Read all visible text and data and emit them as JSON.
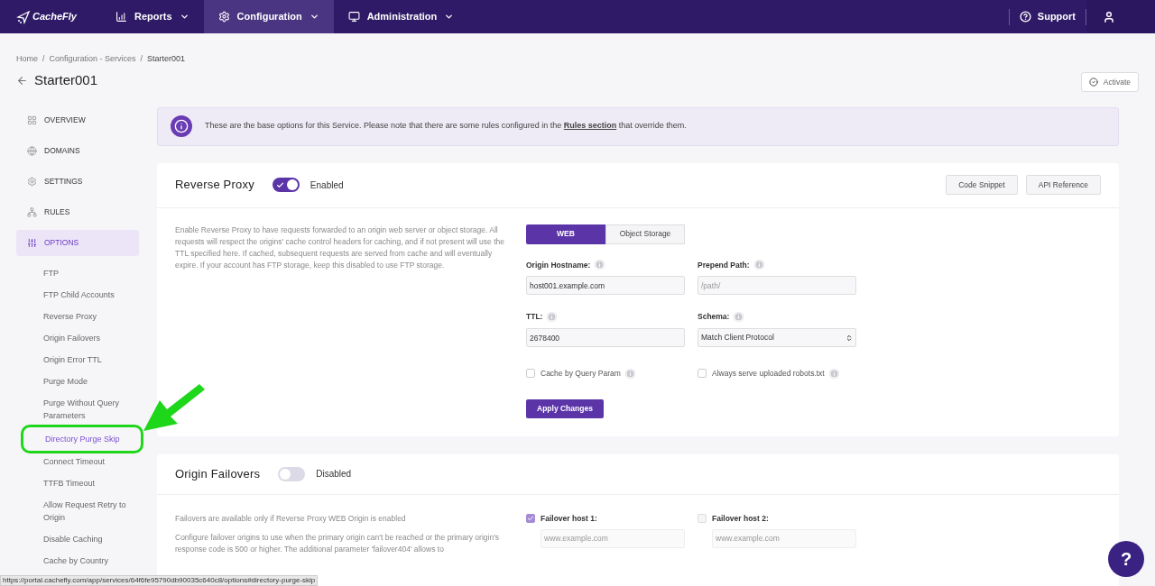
{
  "nav": {
    "logo": "CacheFly",
    "items": [
      {
        "label": "Reports",
        "selected": false
      },
      {
        "label": "Configuration",
        "selected": true
      },
      {
        "label": "Administration",
        "selected": false
      }
    ],
    "support": "Support"
  },
  "breadcrumb": [
    "Home",
    "Configuration - Services",
    "Starter001"
  ],
  "breadcrumb_separator": "/",
  "title": "Starter001",
  "activate_button": "Activate",
  "sidebar": {
    "sections": [
      {
        "label": "OVERVIEW",
        "selected": false
      },
      {
        "label": "DOMAINS",
        "selected": false
      },
      {
        "label": "SETTINGS",
        "selected": false
      },
      {
        "label": "RULES",
        "selected": false
      },
      {
        "label": "OPTIONS",
        "selected": true
      }
    ],
    "subitems": [
      {
        "label": "FTP",
        "selected": false,
        "highlighted": false
      },
      {
        "label": "FTP Child Accounts",
        "selected": false,
        "highlighted": false
      },
      {
        "label": "Reverse Proxy",
        "selected": false,
        "highlighted": false
      },
      {
        "label": "Origin Failovers",
        "selected": false,
        "highlighted": false
      },
      {
        "label": "Origin Error TTL",
        "selected": false,
        "highlighted": false
      },
      {
        "label": "Purge Mode",
        "selected": false,
        "highlighted": false
      },
      {
        "label": "Purge Without Query Parameters",
        "selected": false,
        "highlighted": false
      },
      {
        "label": "Directory Purge Skip",
        "selected": true,
        "highlighted": true
      },
      {
        "label": "Connect Timeout",
        "selected": false,
        "highlighted": false
      },
      {
        "label": "TTFB Timeout",
        "selected": false,
        "highlighted": false
      },
      {
        "label": "Allow Request Retry to Origin",
        "selected": false,
        "highlighted": false
      },
      {
        "label": "Disable Caching",
        "selected": false,
        "highlighted": false
      },
      {
        "label": "Cache by Country",
        "selected": false,
        "highlighted": false
      }
    ]
  },
  "notice": {
    "text_before": "These are the base options for this Service. Please note that there are some rules configured in the",
    "link": "Rules section",
    "text_after": "that override them."
  },
  "reverse_proxy": {
    "title": "Reverse Proxy",
    "toggle": {
      "on": true,
      "label": "Enabled"
    },
    "buttons": [
      "Code Snippet",
      "API Reference"
    ],
    "description": "Enable Reverse Proxy to have requests forwarded to an origin web server or object storage. All requests will respect the origins' cache control headers for caching, and if not present will use the TTL specified here. If cached, subsequent requests are served from cache and will eventually expire. If your account has FTP storage, keep this disabled to use FTP storage.",
    "origin_tabs": [
      {
        "label": "WEB",
        "selected": true
      },
      {
        "label": "Object Storage",
        "selected": false
      }
    ],
    "fields": [
      {
        "kind": "input",
        "label": "Origin Hostname:",
        "value": "host001.example.com"
      },
      {
        "kind": "input",
        "label": "Prepend Path:",
        "placeholder": "/path/"
      },
      {
        "kind": "input",
        "label": "TTL:",
        "value": "2678400"
      },
      {
        "kind": "select",
        "label": "Schema:",
        "value": "Match Client Protocol"
      }
    ],
    "checkboxes": [
      {
        "label": "Cache by Query Param",
        "checked": false
      },
      {
        "label": "Always serve uploaded robots.txt",
        "checked": false
      }
    ],
    "apply_button": "Apply Changes"
  },
  "origin_failovers": {
    "title": "Origin Failovers",
    "toggle": {
      "on": false,
      "label": "Disabled"
    },
    "note": "Failovers are available only if Reverse Proxy WEB Origin is enabled",
    "description": "Configure failover origins to use when the primary origin can't be reached or the primary origin's response code is 500 or higher. The additional parameter 'failover404' allows to",
    "hosts": [
      {
        "label": "Failover host 1:",
        "checked": true,
        "placeholder": "www.example.com"
      },
      {
        "label": "Failover host 2:",
        "checked": false,
        "placeholder": "www.example.com"
      }
    ]
  },
  "status_url": "https://portal.cachefly.com/app/services/64f6fe95790db90035c640c8/options#directory-purge-skip",
  "help_button": "?"
}
